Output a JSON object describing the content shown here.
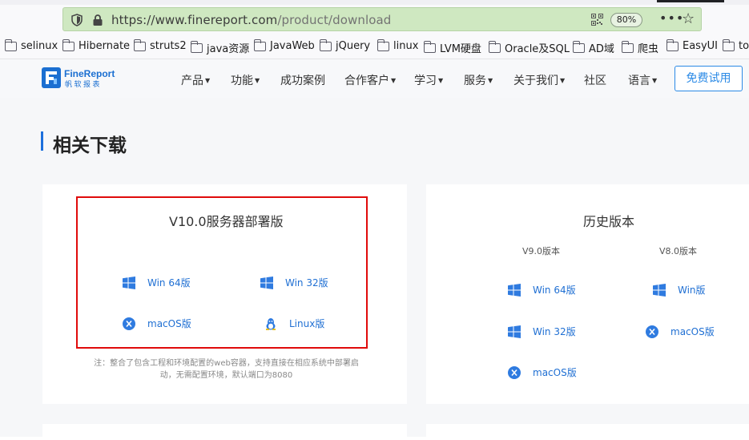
{
  "browser": {
    "url_main": "https://www.finereport.com",
    "url_path": "/product/download",
    "zoom": "80%",
    "more_label": "•••",
    "star_label": "☆"
  },
  "bookmarks": [
    {
      "label": "selinux"
    },
    {
      "label": "Hibernate"
    },
    {
      "label": "struts2"
    },
    {
      "label": "java资源"
    },
    {
      "label": "JavaWeb"
    },
    {
      "label": "jQuery"
    },
    {
      "label": "linux"
    },
    {
      "label": "LVM硬盘"
    },
    {
      "label": "Oracle及SQL"
    },
    {
      "label": "AD域"
    },
    {
      "label": "爬虫"
    },
    {
      "label": "EasyUI"
    },
    {
      "label": "to"
    }
  ],
  "site": {
    "logo_name": "FineReport",
    "logo_sub": "帆软报表",
    "menu": [
      "产品",
      "功能",
      "成功案例",
      "合作客户",
      "学习",
      "服务",
      "关于我们",
      "社区",
      "语言"
    ],
    "cta_label": "免费试用"
  },
  "section": {
    "title": "相关下载"
  },
  "server_card": {
    "title": "V10.0服务器部署版",
    "items": [
      {
        "label": "Win 64版",
        "icon": "windows-icon"
      },
      {
        "label": "Win 32版",
        "icon": "windows-icon"
      },
      {
        "label": "macOS版",
        "icon": "macos-icon"
      },
      {
        "label": "Linux版",
        "icon": "linux-icon"
      }
    ],
    "note": "注：整合了包含工程和环境配置的web容器，支持直接在相应系统中部署启动，无需配置环境，默认端口为8080"
  },
  "history_card": {
    "title": "历史版本",
    "v9": {
      "head": "V9.0版本",
      "items": [
        {
          "label": "Win 64版",
          "icon": "windows-icon"
        },
        {
          "label": "Win 32版",
          "icon": "windows-icon"
        },
        {
          "label": "macOS版",
          "icon": "macos-icon"
        }
      ]
    },
    "v8": {
      "head": "V8.0版本",
      "items": [
        {
          "label": "Win版",
          "icon": "windows-icon"
        },
        {
          "label": "macOS版",
          "icon": "macos-icon"
        }
      ]
    }
  },
  "colors": {
    "accent": "#1f6fd3",
    "highlight_border": "#e00b0b",
    "urlbar_bg": "#cfe8c1"
  }
}
